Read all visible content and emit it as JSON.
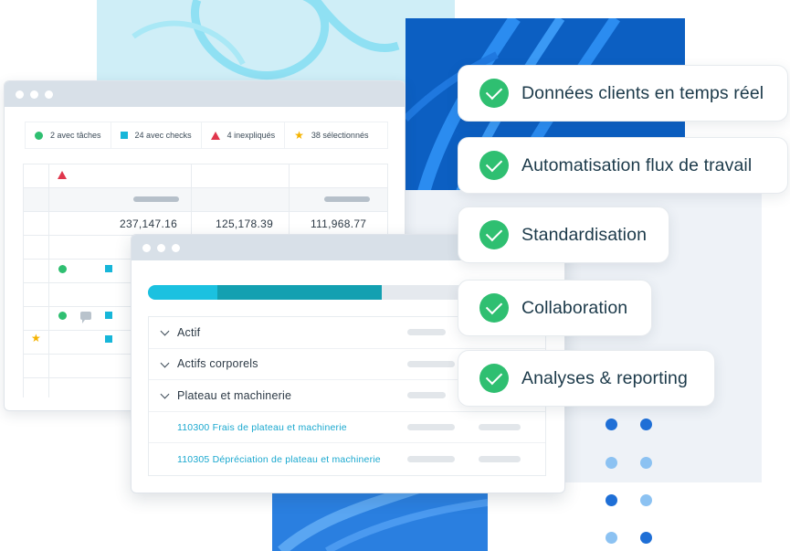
{
  "legend": [
    {
      "icon": "circle-marker",
      "label": "2 avec tâches",
      "color": "#2fbf71"
    },
    {
      "icon": "square-marker",
      "label": "24 avec checks",
      "color": "#17b6d9"
    },
    {
      "icon": "triangle-marker",
      "label": "4 inexpliqués",
      "color": "#e0364c"
    },
    {
      "icon": "star-marker",
      "label": "38 sélectionnés",
      "color": "#f5b301"
    }
  ],
  "table": {
    "values": [
      "237,147.16",
      "125,178.39",
      "111,968.77"
    ]
  },
  "progress": {
    "segment_a": 0.18,
    "segment_b": 0.43,
    "colors": [
      "#1bc1e0",
      "#13a0b1"
    ]
  },
  "tree": [
    {
      "label": "Actif",
      "type": "group"
    },
    {
      "label": "Actifs corporels",
      "type": "group"
    },
    {
      "label": "Plateau et machinerie",
      "type": "group"
    },
    {
      "label": "110300 Frais de plateau et machinerie",
      "type": "account"
    },
    {
      "label": "110305 Dépréciation de plateau et machinerie",
      "type": "account"
    }
  ],
  "features": [
    "Données clients en temps réel",
    "Automatisation flux de travail",
    "Standardisation",
    "Collaboration",
    "Analyses & reporting"
  ],
  "colors": {
    "accent_green": "#2fbf71",
    "accent_blue": "#0c5fc2",
    "link": "#1aa8cf"
  }
}
